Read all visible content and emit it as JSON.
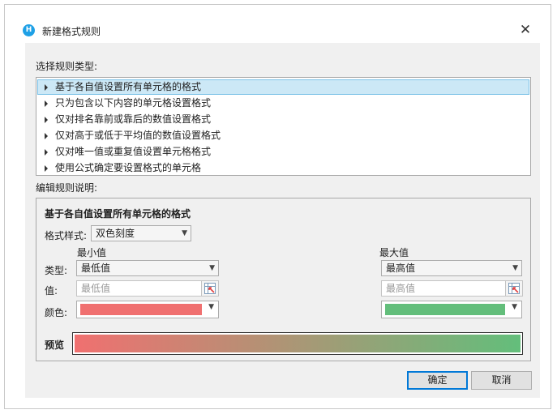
{
  "window": {
    "title": "新建格式规则",
    "icon_letter": "H"
  },
  "select_type_label": "选择规则类型:",
  "rule_types": [
    "基于各自值设置所有单元格的格式",
    "只为包含以下内容的单元格设置格式",
    "仅对排名靠前或靠后的数值设置格式",
    "仅对高于或低于平均值的数值设置格式",
    "仅对唯一值或重复值设置单元格格式",
    "使用公式确定要设置格式的单元格"
  ],
  "selected_rule_index": 0,
  "edit_desc_label": "编辑规则说明:",
  "edit": {
    "heading": "基于各自值设置所有单元格的格式",
    "format_style_label": "格式样式:",
    "format_style_value": "双色刻度",
    "min_header": "最小值",
    "max_header": "最大值",
    "type_label": "类型:",
    "value_label": "值:",
    "color_label": "颜色:",
    "min_type": "最低值",
    "max_type": "最高值",
    "min_value_placeholder": "最低值",
    "max_value_placeholder": "最高值",
    "min_color": "#f07070",
    "max_color": "#63be7b",
    "preview_label": "预览"
  },
  "buttons": {
    "ok": "确定",
    "cancel": "取消"
  }
}
